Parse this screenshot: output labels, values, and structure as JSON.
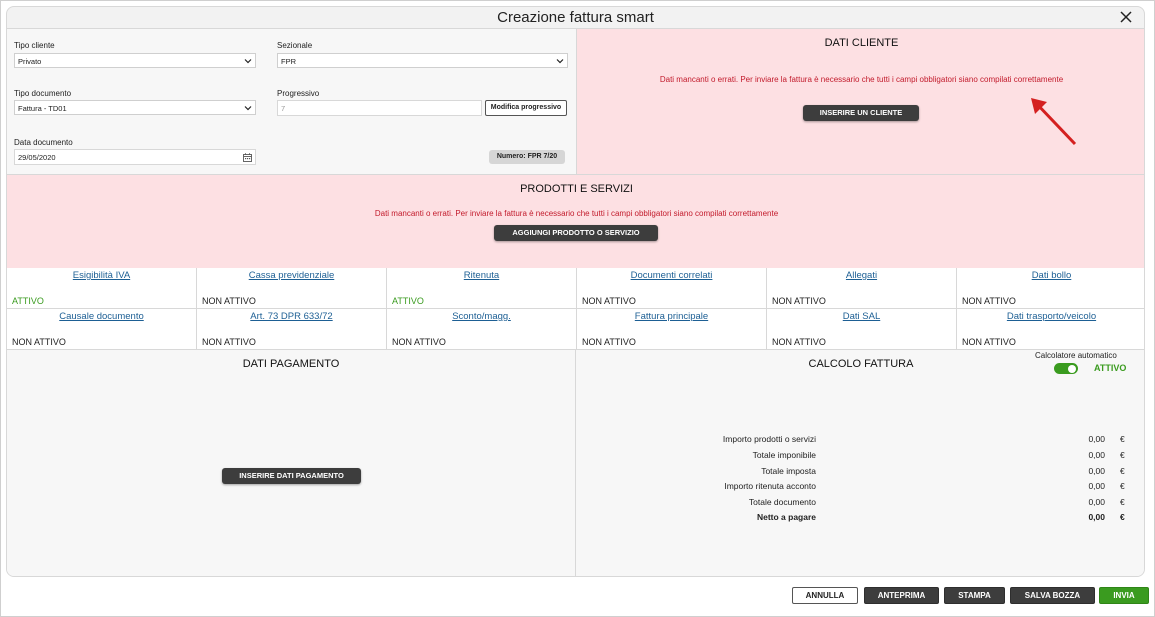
{
  "window": {
    "title": "Creazione fattura smart"
  },
  "form": {
    "tipo_cliente": {
      "label": "Tipo cliente",
      "value": "Privato"
    },
    "sezionale": {
      "label": "Sezionale",
      "value": "FPR"
    },
    "tipo_documento": {
      "label": "Tipo documento",
      "value": "Fattura - TD01"
    },
    "progressivo": {
      "label": "Progressivo",
      "placeholder": "7",
      "button": "Modifica progressivo"
    },
    "data_documento": {
      "label": "Data documento",
      "value": "29/05/2020"
    },
    "numero": "Numero: FPR 7/20"
  },
  "dati_cliente": {
    "title": "DATI CLIENTE",
    "error": "Dati mancanti o errati. Per inviare la fattura è necessario che tutti i campi obbligatori siano compilati correttamente",
    "button": "INSERIRE UN CLIENTE"
  },
  "prodotti": {
    "title": "PRODOTTI E SERVIZI",
    "error": "Dati mancanti o errati. Per inviare la fattura è necessario che tutti i campi obbligatori siano compilati correttamente",
    "button": "AGGIUNGI PRODOTTO O SERVIZIO"
  },
  "options": [
    {
      "label": "Esigibilità IVA",
      "status": "ATTIVO"
    },
    {
      "label": "Cassa previdenziale",
      "status": "NON ATTIVO"
    },
    {
      "label": "Ritenuta",
      "status": "ATTIVO"
    },
    {
      "label": "Documenti correlati",
      "status": "NON ATTIVO"
    },
    {
      "label": "Allegati",
      "status": "NON ATTIVO"
    },
    {
      "label": "Dati bollo",
      "status": "NON ATTIVO"
    },
    {
      "label": "Causale documento",
      "status": "NON ATTIVO"
    },
    {
      "label": "Art. 73 DPR 633/72",
      "status": "NON ATTIVO"
    },
    {
      "label": "Sconto/magg.",
      "status": "NON ATTIVO"
    },
    {
      "label": "Fattura principale",
      "status": "NON ATTIVO"
    },
    {
      "label": "Dati SAL",
      "status": "NON ATTIVO"
    },
    {
      "label": "Dati trasporto/veicolo",
      "status": "NON ATTIVO"
    }
  ],
  "pagamento": {
    "title": "DATI PAGAMENTO",
    "button": "INSERIRE DATI PAGAMENTO"
  },
  "calcolo": {
    "title": "CALCOLO FATTURA",
    "auto_label": "Calcolatore automatico",
    "auto_status": "ATTIVO",
    "rows": [
      {
        "label": "Importo prodotti o servizi",
        "value": "0,00",
        "currency": "€"
      },
      {
        "label": "Totale imponibile",
        "value": "0,00",
        "currency": "€"
      },
      {
        "label": "Totale imposta",
        "value": "0,00",
        "currency": "€"
      },
      {
        "label": "Importo ritenuta acconto",
        "value": "0,00",
        "currency": "€"
      },
      {
        "label": "Totale documento",
        "value": "0,00",
        "currency": "€"
      },
      {
        "label": "Netto a pagare",
        "value": "0,00",
        "currency": "€"
      }
    ]
  },
  "footer": {
    "annulla": "ANNULLA",
    "anteprima": "ANTEPRIMA",
    "stampa": "STAMPA",
    "salva_bozza": "SALVA BOZZA",
    "invia": "INVIA"
  },
  "colors": {
    "error_text": "#c21a2b",
    "error_bg": "#fde0e3",
    "active": "#3a9b1f",
    "link": "#1d5f94",
    "dark_button": "#3d3d3d"
  }
}
